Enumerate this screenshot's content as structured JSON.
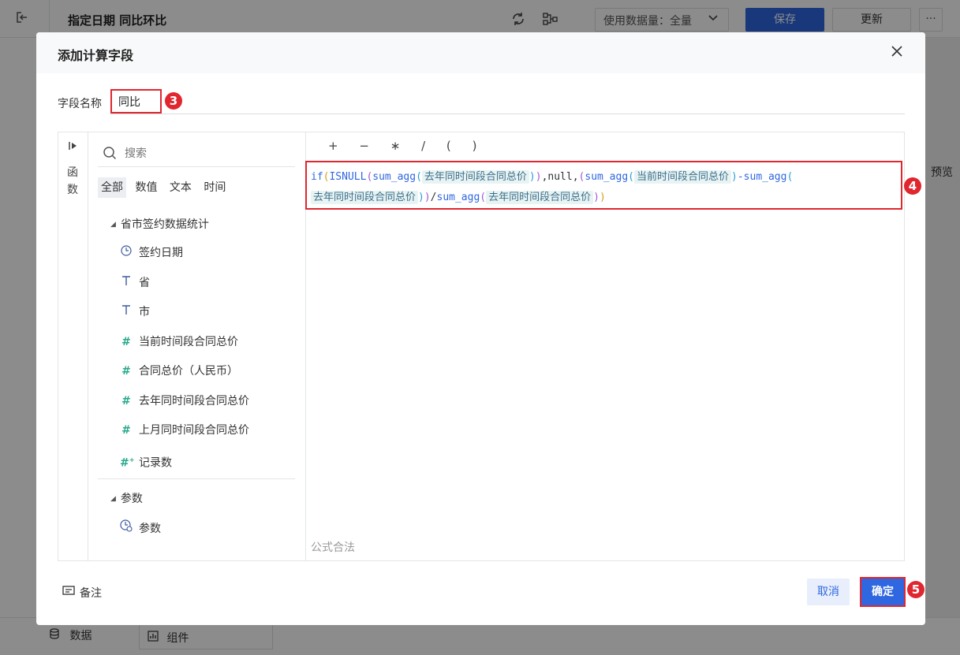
{
  "app": {
    "title": "指定日期 同比环比",
    "data_volume_label": "使用数据量：全量",
    "save_label": "保存",
    "update_label": "更新",
    "more_label": "···",
    "right_preview_text": "预览",
    "bottom_data_label": "数据",
    "bottom_component_label": "组件"
  },
  "dialog": {
    "title": "添加计算字段",
    "field_name_label": "字段名称",
    "field_name_value": "同比",
    "functions_label": "函数",
    "search_placeholder": "搜索",
    "tabs": [
      "全部",
      "数值",
      "文本",
      "时间"
    ],
    "dataset_group": "省市签约数据统计",
    "fields": [
      {
        "icon": "clock-icon",
        "label": "签约日期"
      },
      {
        "icon": "text-type-icon",
        "label": "省"
      },
      {
        "icon": "text-type-icon",
        "label": "市"
      },
      {
        "icon": "number-type-icon",
        "label": "当前时间段合同总价"
      },
      {
        "icon": "number-type-icon",
        "label": "合同总价（人民币）"
      },
      {
        "icon": "number-type-icon",
        "label": "去年同时间段合同总价"
      },
      {
        "icon": "number-type-icon",
        "label": "上月同时间段合同总价"
      },
      {
        "icon": "record-count-icon",
        "label": "记录数"
      }
    ],
    "param_group": "参数",
    "param_item": "参数",
    "operators": [
      "+",
      "−",
      "∗",
      "/",
      "(",
      ")"
    ],
    "formula": {
      "fn_if": "if",
      "fn_isnull": "ISNULL",
      "fn_sum_agg": "sum_agg",
      "field_last_year": "去年同时间段合同总价",
      "field_current": "当前时间段合同总价",
      "null_text": ",null,",
      "minus": "-",
      "divide": "/"
    },
    "status": "公式合法",
    "remark_label": "备注",
    "cancel_label": "取消",
    "ok_label": "确定"
  },
  "annotations": {
    "badge_3": "3",
    "badge_4": "4",
    "badge_5": "5"
  },
  "colors": {
    "primary": "#2f67e0",
    "highlight_red": "#e0262f",
    "number_icon": "#29a88a"
  }
}
